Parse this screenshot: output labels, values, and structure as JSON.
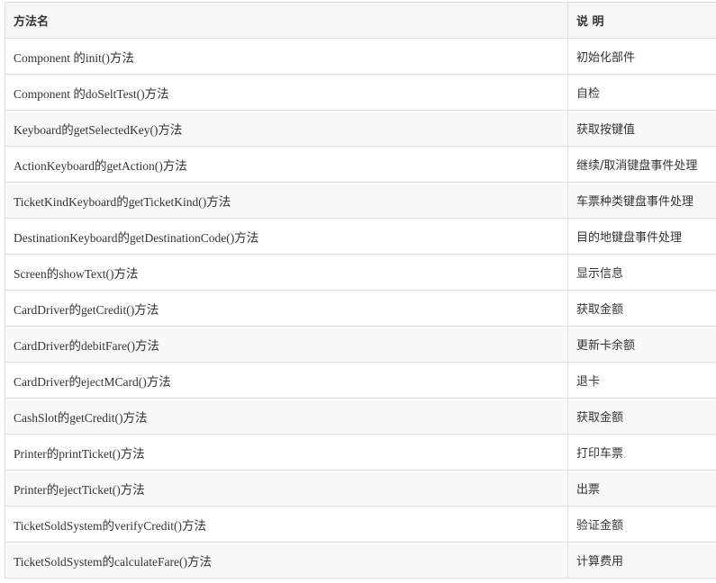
{
  "table": {
    "headers": [
      "方法名",
      "说 明"
    ],
    "rows": [
      {
        "method": "Component 的init()方法",
        "description": "初始化部件"
      },
      {
        "method": "Component 的doSeltTest()方法",
        "description": "自检"
      },
      {
        "method": "Keyboard的getSelectedKey()方法",
        "description": "获取按键值"
      },
      {
        "method": "ActionKeyboard的getAction()方法",
        "description": "继续/取消键盘事件处理"
      },
      {
        "method": "TicketKindKeyboard的getTicketKind()方法",
        "description": "车票种类键盘事件处理"
      },
      {
        "method": "DestinationKeyboard的getDestinationCode()方法",
        "description": "目的地键盘事件处理"
      },
      {
        "method": "Screen的showText()方法",
        "description": "显示信息"
      },
      {
        "method": "CardDriver的getCredit()方法",
        "description": "获取金额"
      },
      {
        "method": "CardDriver的debitFare()方法",
        "description": "更新卡余额"
      },
      {
        "method": "CardDriver的ejectMCard()方法",
        "description": "退卡"
      },
      {
        "method": "CashSlot的getCredit()方法",
        "description": "获取金额"
      },
      {
        "method": "Printer的printTicket()方法",
        "description": "打印车票"
      },
      {
        "method": "Printer的ejectTicket()方法",
        "description": "出票"
      },
      {
        "method": "TicketSoldSystem的verifyCredit()方法",
        "description": "验证金额"
      },
      {
        "method": "TicketSoldSystem的calculateFare()方法",
        "description": "计算费用"
      }
    ]
  }
}
